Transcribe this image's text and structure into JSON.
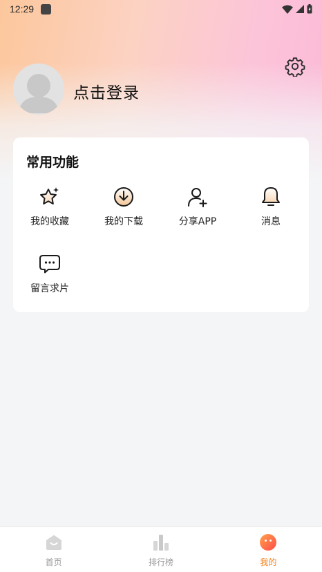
{
  "status_bar": {
    "time": "12:29",
    "icons": [
      "app-notification-icon",
      "wifi-icon",
      "signal-icon",
      "battery-icon"
    ]
  },
  "header": {
    "login_text": "点击登录",
    "settings_icon": "gear-icon",
    "avatar_icon": "default-user-avatar"
  },
  "common_functions": {
    "title": "常用功能",
    "items": [
      {
        "label": "我的收藏",
        "icon": "star-sparkle-icon"
      },
      {
        "label": "我的下载",
        "icon": "download-circle-icon"
      },
      {
        "label": "分享APP",
        "icon": "add-user-icon"
      },
      {
        "label": "消息",
        "icon": "bell-icon"
      },
      {
        "label": "留言求片",
        "icon": "chat-bubble-icon"
      }
    ]
  },
  "tabbar": {
    "tabs": [
      {
        "label": "首页",
        "icon": "home-icon",
        "active": false
      },
      {
        "label": "排行榜",
        "icon": "bar-chart-icon",
        "active": false
      },
      {
        "label": "我的",
        "icon": "face-icon",
        "active": true
      }
    ]
  },
  "colors": {
    "accent": "#f4801a",
    "inactive_tab": "#9a9a9a",
    "icon_stroke": "#1a1a1a"
  }
}
